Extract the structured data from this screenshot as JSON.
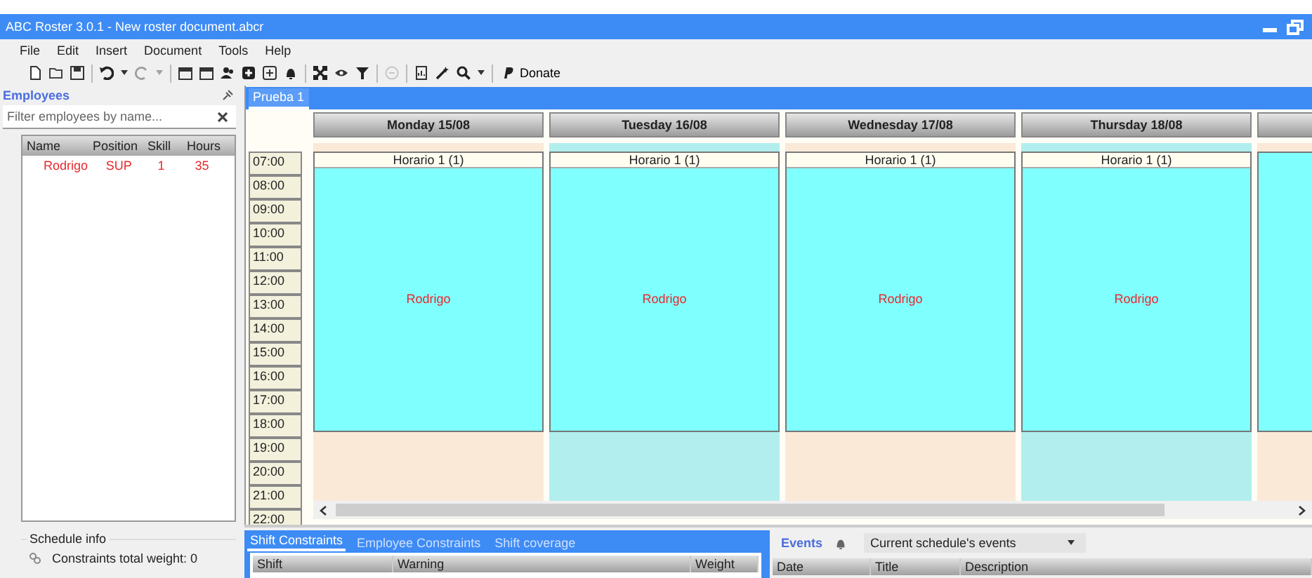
{
  "window": {
    "title": "ABC Roster 3.0.1 - New roster document.abcr"
  },
  "menu": [
    "File",
    "Edit",
    "Insert",
    "Document",
    "Tools",
    "Help"
  ],
  "toolbar": [
    {
      "kind": "new",
      "disabled": false
    },
    {
      "kind": "open",
      "disabled": false
    },
    {
      "kind": "save",
      "disabled": false
    },
    {
      "kind": "sep"
    },
    {
      "kind": "undo",
      "disabled": false
    },
    {
      "kind": "caret",
      "disabled": false
    },
    {
      "kind": "redo",
      "disabled": true
    },
    {
      "kind": "caret",
      "disabled": true
    },
    {
      "kind": "sep"
    },
    {
      "kind": "calendar",
      "disabled": false
    },
    {
      "kind": "calendar",
      "disabled": false
    },
    {
      "kind": "users",
      "disabled": false
    },
    {
      "kind": "plus",
      "disabled": false
    },
    {
      "kind": "plus-outline",
      "disabled": false
    },
    {
      "kind": "bell",
      "disabled": false
    },
    {
      "kind": "sep"
    },
    {
      "kind": "expand",
      "disabled": false
    },
    {
      "kind": "eye",
      "disabled": false
    },
    {
      "kind": "filter",
      "disabled": false
    },
    {
      "kind": "sep"
    },
    {
      "kind": "circle",
      "disabled": true
    },
    {
      "kind": "sep"
    },
    {
      "kind": "report",
      "disabled": false
    },
    {
      "kind": "wand",
      "disabled": false
    },
    {
      "kind": "search",
      "disabled": false
    },
    {
      "kind": "caret",
      "disabled": false
    },
    {
      "kind": "sep"
    },
    {
      "kind": "donate",
      "label": "Donate",
      "disabled": false
    }
  ],
  "employees": {
    "title": "Employees",
    "filter": {
      "placeholder": "Filter employees by name..."
    },
    "columns": [
      "Name",
      "Position",
      "Skill",
      "Hours"
    ],
    "rows": [
      [
        "Rodrigo",
        "SUP",
        "1",
        "35"
      ]
    ]
  },
  "schedule_info": {
    "title": "Schedule info",
    "items": [
      "Constraints total weight: 0"
    ]
  },
  "schedule": {
    "tabs": [
      {
        "label": "Prueba 1",
        "selected": true
      }
    ],
    "times": [
      "07:00",
      "08:00",
      "09:00",
      "10:00",
      "11:00",
      "12:00",
      "13:00",
      "14:00",
      "15:00",
      "16:00",
      "17:00",
      "18:00",
      "19:00",
      "20:00",
      "21:00",
      "22:00"
    ],
    "days": [
      {
        "label": "Monday 15/08",
        "highlighted": false,
        "shift": {
          "title": "Horario 1 (1)",
          "employee": "Rodrigo"
        }
      },
      {
        "label": "Tuesday 16/08",
        "highlighted": true,
        "shift": {
          "title": "Horario 1 (1)",
          "employee": "Rodrigo"
        }
      },
      {
        "label": "Wednesday 17/08",
        "highlighted": false,
        "shift": {
          "title": "Horario 1 (1)",
          "employee": "Rodrigo"
        }
      },
      {
        "label": "Thursday 18/08",
        "highlighted": true,
        "shift": {
          "title": "Horario 1 (1)",
          "employee": "Rodrigo"
        }
      }
    ]
  },
  "constraints": {
    "tabs": [
      {
        "label": "Shift Constraints",
        "selected": true
      },
      {
        "label": "Employee Constraints",
        "selected": false
      },
      {
        "label": "Shift coverage",
        "selected": false
      }
    ],
    "columns": [
      "Shift",
      "Warning",
      "Weight"
    ]
  },
  "events": {
    "title": "Events",
    "dropdown": "Current schedule's events",
    "columns": [
      "Date",
      "Title",
      "Description"
    ]
  }
}
